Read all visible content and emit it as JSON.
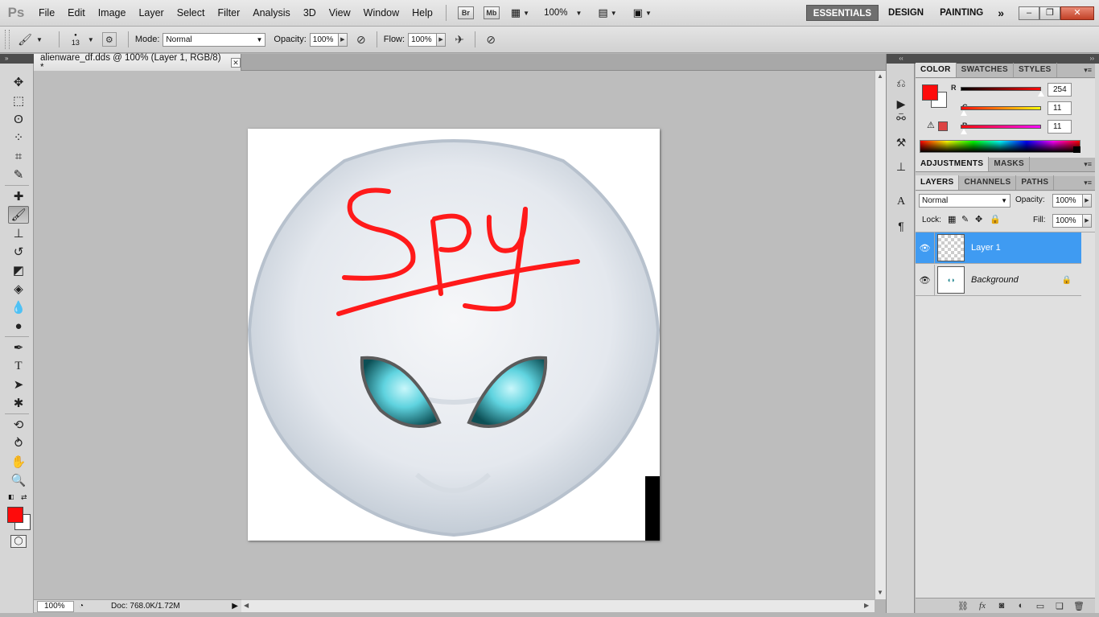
{
  "app": {
    "logo": "Ps"
  },
  "menu": [
    "File",
    "Edit",
    "Image",
    "Layer",
    "Select",
    "Filter",
    "Analysis",
    "3D",
    "View",
    "Window",
    "Help"
  ],
  "app_bar": {
    "bridge": "Br",
    "mini_bridge": "Mb",
    "zoom": "100%"
  },
  "workspaces": {
    "essentials": "ESSENTIALS",
    "design": "DESIGN",
    "painting": "PAINTING",
    "more": "»"
  },
  "window_controls": {
    "minimize": "–",
    "restore": "❐",
    "close": "✕"
  },
  "options": {
    "brush_size": "13",
    "mode_label": "Mode:",
    "mode_value": "Normal",
    "opacity_label": "Opacity:",
    "opacity_value": "100%",
    "flow_label": "Flow:",
    "flow_value": "100%"
  },
  "document": {
    "tab_title": "alienware_df.dds @ 100% (Layer 1, RGB/8) *",
    "tab_close": "✕",
    "drawn_text": "SPY"
  },
  "status": {
    "zoom": "100%",
    "doc_size": "Doc: 768.0K/1.72M"
  },
  "colors": {
    "foreground": "#fe0b0b",
    "background": "#ffffff",
    "brand_red": "#ff1a1a"
  },
  "color_panel": {
    "tabs": [
      "COLOR",
      "SWATCHES",
      "STYLES"
    ],
    "r_label": "R",
    "r_value": "254",
    "g_label": "G",
    "g_value": "11",
    "b_label": "B",
    "b_value": "11",
    "r_fraction": 0.996,
    "g_fraction": 0.043,
    "b_fraction": 0.043
  },
  "adjustments_panel": {
    "tabs": [
      "ADJUSTMENTS",
      "MASKS"
    ]
  },
  "layers_panel": {
    "tabs": [
      "LAYERS",
      "CHANNELS",
      "PATHS"
    ],
    "blend_mode": "Normal",
    "opacity_label": "Opacity:",
    "opacity_value": "100%",
    "lock_label": "Lock:",
    "fill_label": "Fill:",
    "fill_value": "100%",
    "layers": [
      {
        "name": "Layer 1",
        "selected": true
      },
      {
        "name": "Background",
        "selected": false
      }
    ]
  }
}
